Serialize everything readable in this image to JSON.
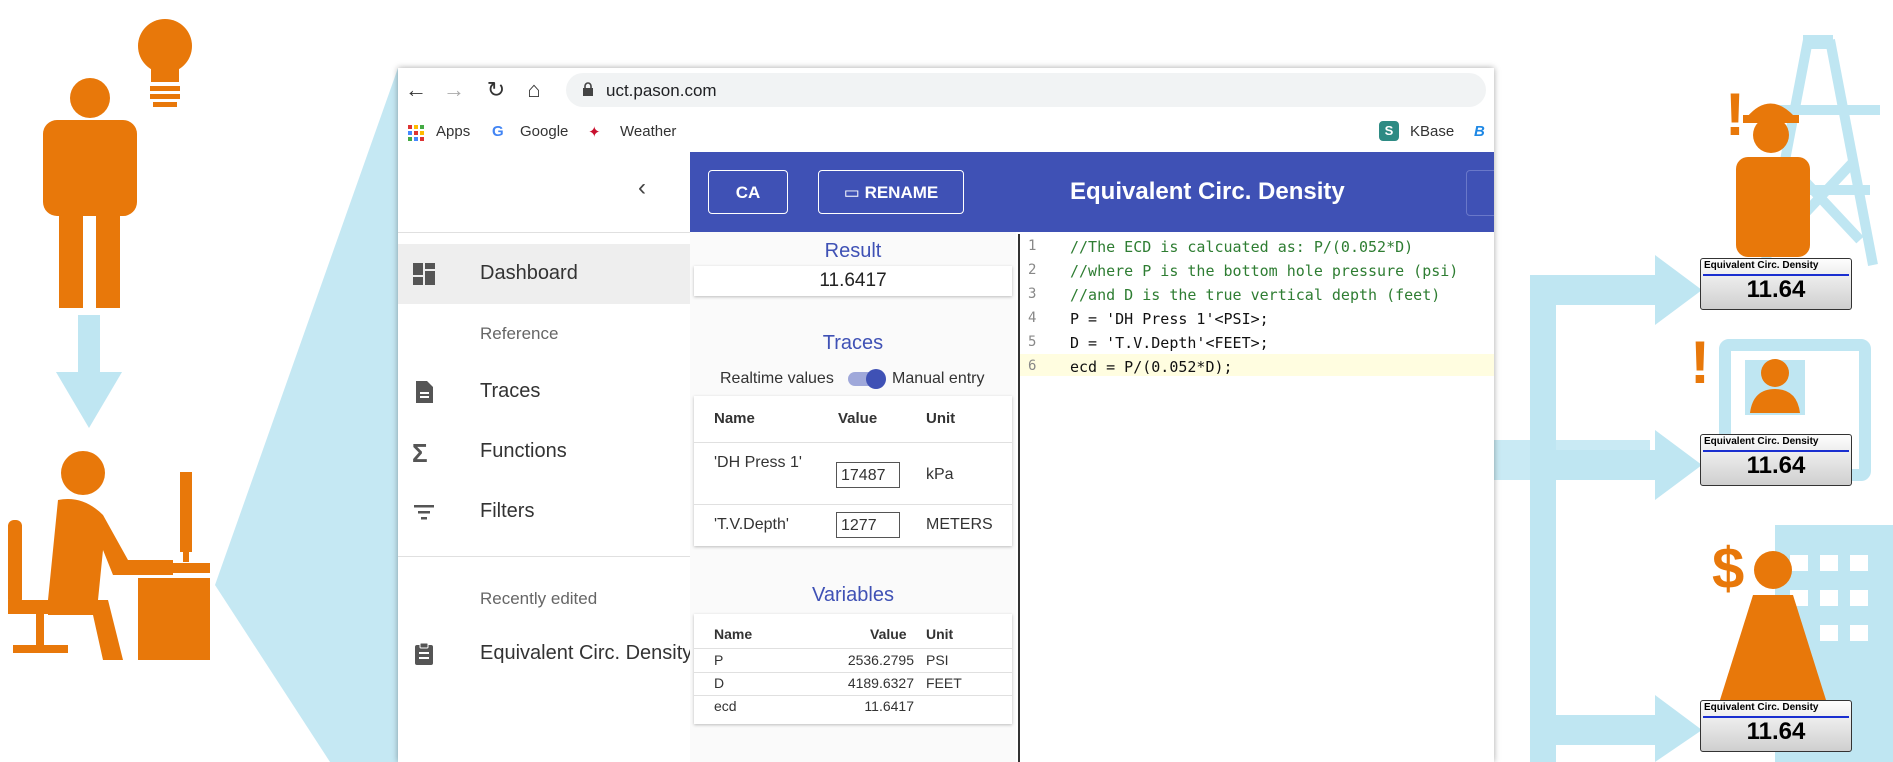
{
  "colors": {
    "orange": "#e8780a",
    "lightblue": "#bfe6f2",
    "indigo": "#3f51b5"
  },
  "browser": {
    "url": "uct.pason.com",
    "bookmarks": {
      "apps": "Apps",
      "google": "Google",
      "weather": "Weather",
      "kbase": "KBase"
    }
  },
  "sidebar": {
    "items": [
      {
        "label": "Dashboard",
        "icon": "dashboard-icon"
      },
      {
        "label": "Traces",
        "icon": "document-icon"
      },
      {
        "label": "Functions",
        "icon": "sigma-icon"
      },
      {
        "label": "Filters",
        "icon": "filter-icon"
      },
      {
        "label": "Equivalent Circ. Density",
        "icon": "clipboard-icon"
      }
    ],
    "reference_label": "Reference",
    "recent_label": "Recently edited"
  },
  "toolbar": {
    "ca_label": "CA",
    "rename_label": "RENAME",
    "title": "Equivalent Circ. Density"
  },
  "result": {
    "title": "Result",
    "value": "11.6417"
  },
  "traces": {
    "title": "Traces",
    "realtime_label": "Realtime values",
    "manual_label": "Manual entry",
    "headers": [
      "Name",
      "Value",
      "Unit"
    ],
    "rows": [
      {
        "name": "'DH Press 1'",
        "value": "17487",
        "unit": "kPa"
      },
      {
        "name": "'T.V.Depth'",
        "value": "1277",
        "unit": "METERS"
      }
    ]
  },
  "variables": {
    "title": "Variables",
    "headers": [
      "Name",
      "Value",
      "Unit"
    ],
    "rows": [
      {
        "name": "P",
        "value": "2536.2795",
        "unit": "PSI"
      },
      {
        "name": "D",
        "value": "4189.6327",
        "unit": "FEET"
      },
      {
        "name": "ecd",
        "value": "11.6417",
        "unit": ""
      }
    ]
  },
  "editor": {
    "lines": [
      {
        "n": "1",
        "text": "//The ECD is calcuated as: P/(0.052*D)"
      },
      {
        "n": "2",
        "text": "//where P is the bottom hole pressure (psi)"
      },
      {
        "n": "3",
        "text": "//and D is the true vertical depth (feet)"
      },
      {
        "n": "4",
        "text": "P = 'DH Press 1'<PSI>;"
      },
      {
        "n": "5",
        "text": "D = 'T.V.Depth'<FEET>;"
      },
      {
        "n": "6",
        "text": "ecd = P/(0.052*D);"
      }
    ]
  },
  "panels": [
    {
      "title": "Equivalent Circ. Density",
      "value": "11.64"
    },
    {
      "title": "Equivalent Circ. Density",
      "value": "11.64"
    },
    {
      "title": "Equivalent Circ. Density",
      "value": "11.64"
    }
  ],
  "symbols": {
    "exclaim": "!",
    "dollar": "$"
  }
}
